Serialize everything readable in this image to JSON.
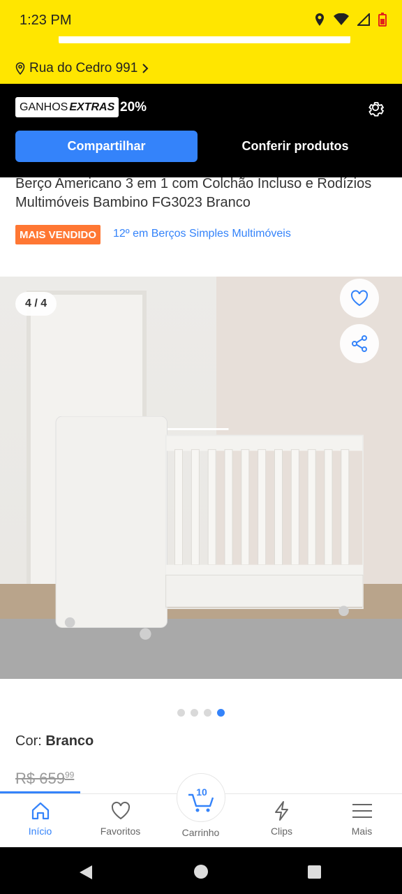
{
  "status_bar": {
    "time": "1:23 PM"
  },
  "address": {
    "text": "Rua do Cedro 991"
  },
  "promo": {
    "badge_prefix": "GANHOS",
    "badge_emphasis": "EXTRAS",
    "percent": "20%",
    "share_button": "Compartilhar",
    "check_button": "Conferir produtos"
  },
  "product": {
    "title": "Berço Americano 3 em 1 com Colchão Incluso e Rodízios Multimóveis Bambino FG3023 Branco",
    "best_seller": "MAIS VENDIDO",
    "ranking": "12º em Berços Simples Multimóveis",
    "gallery_counter": "4 / 4",
    "color_label": "Cor: ",
    "color_value": "Branco",
    "old_price_main": "R$ 659",
    "old_price_cents": "99"
  },
  "carousel": {
    "total": 4,
    "active_index": 3
  },
  "bottom_nav": {
    "home": "Início",
    "favorites": "Favoritos",
    "cart": "Carrinho",
    "cart_count": "10",
    "clips": "Clips",
    "more": "Mais"
  },
  "colors": {
    "accent": "#3483fa",
    "brand_yellow": "#ffe600",
    "best_seller": "#ff7733"
  }
}
